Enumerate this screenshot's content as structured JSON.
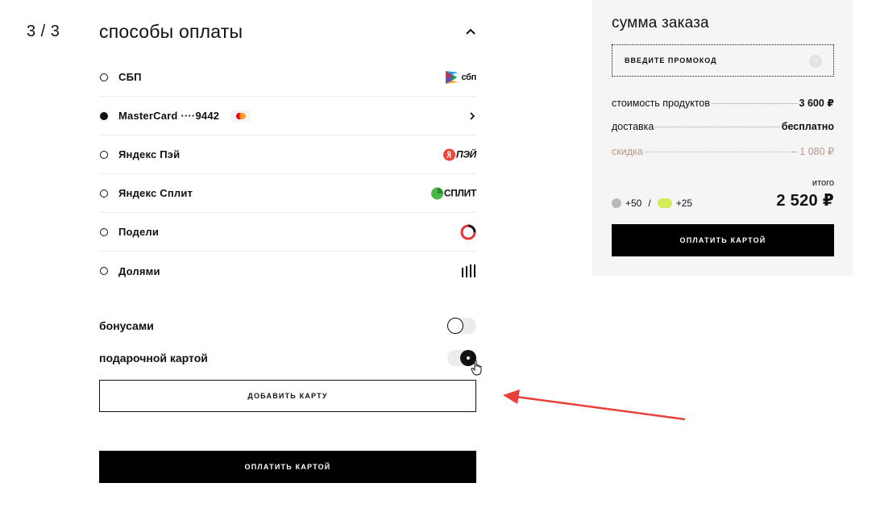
{
  "step": "3 / 3",
  "payment": {
    "title": "способы оплаты",
    "methods": [
      {
        "label": "СБП",
        "selected": false,
        "logo": "сбп",
        "logo_icon": "sbp-logo-icon"
      },
      {
        "label": "MasterCard ····9442",
        "selected": true,
        "logo_icon": "chevron-right-icon"
      },
      {
        "label": "Яндекс Пэй",
        "selected": false,
        "logo": "ПЭЙ",
        "logo_icon": "yandex-pay-logo-icon"
      },
      {
        "label": "Яндекс Сплит",
        "selected": false,
        "logo": "СПЛИТ",
        "logo_icon": "yandex-split-logo-icon"
      },
      {
        "label": "Подели",
        "selected": false,
        "logo_icon": "podeli-logo-icon"
      },
      {
        "label": "Долями",
        "selected": false,
        "logo_icon": "dolyami-logo-icon"
      }
    ],
    "bonuses_label": "бонусами",
    "bonuses_on": false,
    "giftcard_label": "подарочной картой",
    "giftcard_on": true,
    "add_card_label": "ДОБАВИТЬ КАРТУ",
    "pay_label": "ОПЛАТИТЬ КАРТОЙ"
  },
  "summary": {
    "title": "сумма заказа",
    "promo_placeholder": "ВВЕДИТЕ ПРОМОКОД",
    "rows": [
      {
        "label": "стоимость продуктов",
        "value": "3 600 ₽"
      },
      {
        "label": "доставка",
        "value": "бесплатно"
      },
      {
        "label": "скидка",
        "value": "– 1 080 ₽"
      }
    ],
    "total_label": "итого",
    "total_value": "2 520 ₽",
    "bonus_a": "+50",
    "bonus_sep": "/",
    "bonus_b": "+25",
    "pay_label": "ОПЛАТИТЬ КАРТОЙ"
  },
  "colors": {
    "discount": "#b6978a",
    "annotation_arrow": "#e8413a",
    "bonus_green": "#d4ec5a"
  }
}
